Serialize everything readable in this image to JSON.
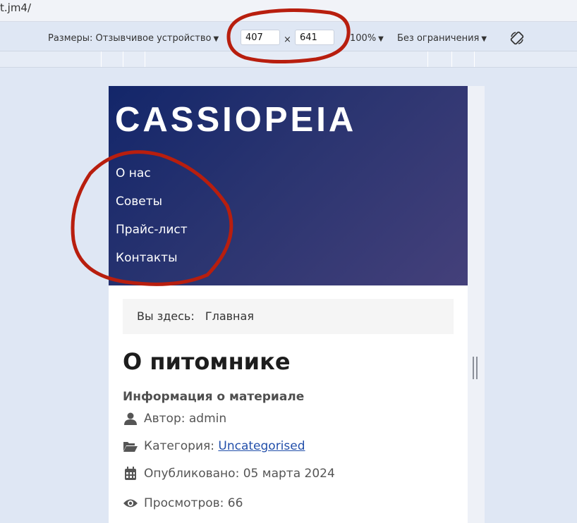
{
  "browser": {
    "url_fragment": "t.jm4/"
  },
  "devtools": {
    "dimensions_label": "Размеры: Отзывчивое устройство",
    "width": "407",
    "height": "641",
    "separator": "×",
    "zoom": "100%",
    "throttle": "Без ограничения"
  },
  "site": {
    "title": "CASSIOPEIA",
    "nav": [
      {
        "label": "О нас"
      },
      {
        "label": "Советы"
      },
      {
        "label": "Прайс-лист"
      },
      {
        "label": "Контакты"
      }
    ]
  },
  "breadcrumb": {
    "prefix": "Вы здесь:",
    "home": "Главная"
  },
  "article": {
    "title": "О питомнике",
    "info_heading": "Информация о материале",
    "author_label": "Автор:",
    "author": "admin",
    "category_label": "Категория:",
    "category": "Uncategorised",
    "published_label": "Опубликовано:",
    "published": "05 марта 2024",
    "views_label": "Просмотров:",
    "views": "66"
  },
  "colors": {
    "header_start": "#13266a",
    "header_end": "#44407a",
    "annotation": "#b81e0e",
    "link": "#224faa"
  }
}
